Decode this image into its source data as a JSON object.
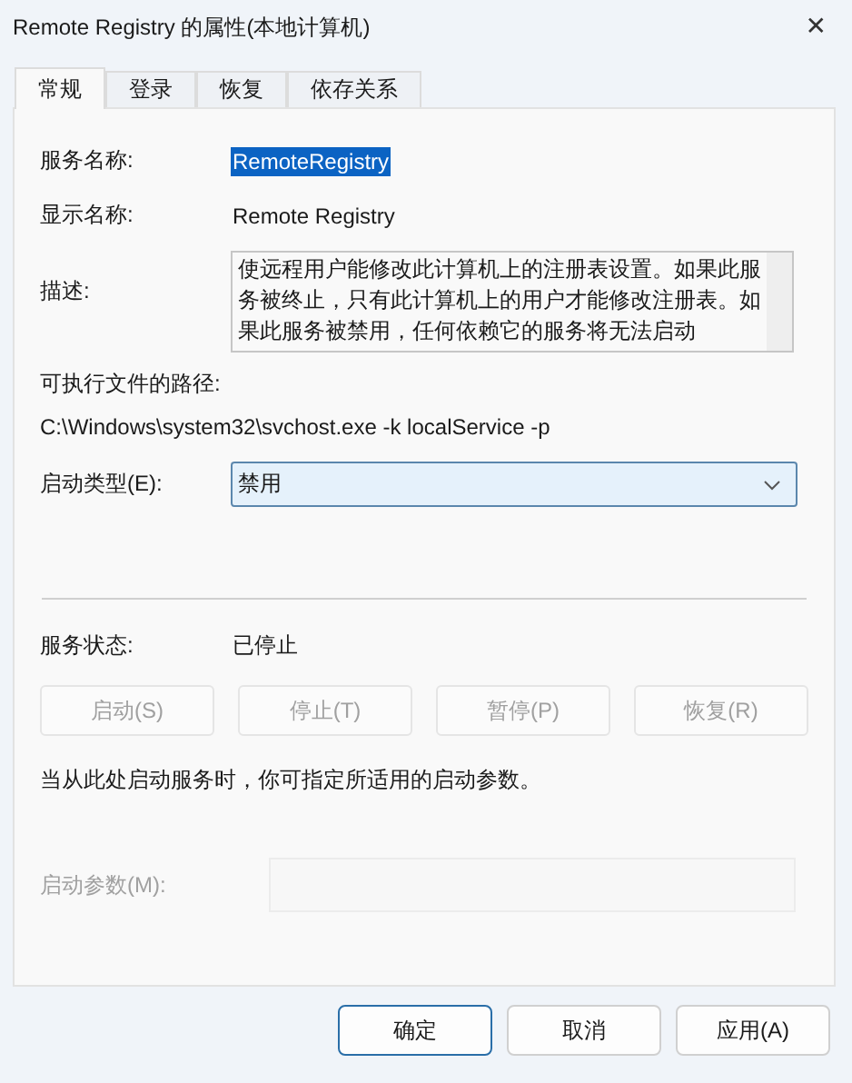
{
  "window": {
    "title": "Remote Registry 的属性(本地计算机)",
    "close": "✕"
  },
  "tabs": [
    {
      "label": "常规",
      "selected": true
    },
    {
      "label": "登录",
      "selected": false
    },
    {
      "label": "恢复",
      "selected": false
    },
    {
      "label": "依存关系",
      "selected": false
    }
  ],
  "service_name": {
    "label": "服务名称:",
    "value": "RemoteRegistry",
    "selected": true
  },
  "display_name": {
    "label": "显示名称:",
    "value": "Remote Registry"
  },
  "description": {
    "label": "描述:",
    "lines": [
      "使远程用户能修改此计算机上的注册表设置。如果此服",
      "务被终止，只有此计算机上的用户才能修改注册表。如",
      "果此服务被禁用，任何依赖它的服务将无法启动"
    ]
  },
  "executable_path": {
    "label": "可执行文件的路径:",
    "value": "C:\\Windows\\system32\\svchost.exe -k localService -p"
  },
  "startup_type": {
    "label": "启动类型(E):",
    "value": "禁用"
  },
  "service_status": {
    "label": "服务状态:",
    "value": "已停止"
  },
  "control_buttons": [
    {
      "label": "启动(S)",
      "disabled": true
    },
    {
      "label": "停止(T)",
      "disabled": true
    },
    {
      "label": "暂停(P)",
      "disabled": true
    },
    {
      "label": "恢复(R)",
      "disabled": true
    }
  ],
  "hint": "当从此处启动服务时，你可指定所适用的启动参数。",
  "start_parameters": {
    "label": "启动参数(M):",
    "disabled": true
  },
  "dialog_buttons": [
    {
      "label": "确定",
      "default": true
    },
    {
      "label": "取消",
      "default": false
    },
    {
      "label": "应用(A)",
      "default": false
    }
  ]
}
